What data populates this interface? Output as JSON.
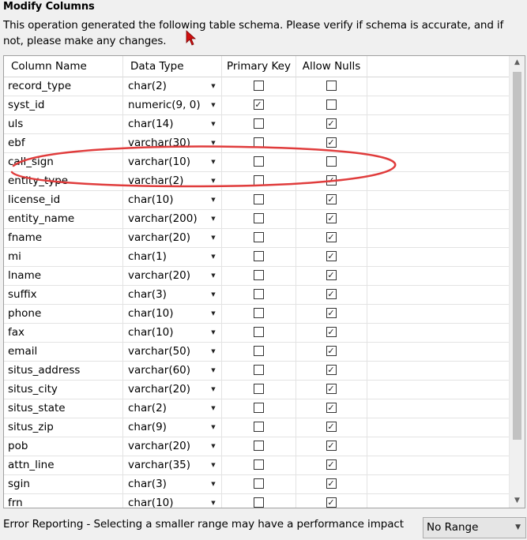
{
  "header": {
    "title": "Modify Columns",
    "description": "This operation generated the following table schema. Please verify if schema is accurate, and if not, please make any changes."
  },
  "grid": {
    "columns": [
      "Column Name",
      "Data Type",
      "Primary Key",
      "Allow Nulls"
    ],
    "rows": [
      {
        "name": "record_type",
        "type": "char(2)",
        "pk": false,
        "nulls": false
      },
      {
        "name": "syst_id",
        "type": "numeric(9, 0)",
        "pk": true,
        "nulls": false
      },
      {
        "name": "uls",
        "type": "char(14)",
        "pk": false,
        "nulls": true
      },
      {
        "name": "ebf",
        "type": "varchar(30)",
        "pk": false,
        "nulls": true
      },
      {
        "name": "call_sign",
        "type": "varchar(10)",
        "pk": false,
        "nulls": false
      },
      {
        "name": "entity_type",
        "type": "varchar(2)",
        "pk": false,
        "nulls": true
      },
      {
        "name": "license_id",
        "type": "char(10)",
        "pk": false,
        "nulls": true
      },
      {
        "name": "entity_name",
        "type": "varchar(200)",
        "pk": false,
        "nulls": true
      },
      {
        "name": "fname",
        "type": "varchar(20)",
        "pk": false,
        "nulls": true
      },
      {
        "name": "mi",
        "type": "char(1)",
        "pk": false,
        "nulls": true
      },
      {
        "name": "lname",
        "type": "varchar(20)",
        "pk": false,
        "nulls": true
      },
      {
        "name": "suffix",
        "type": "char(3)",
        "pk": false,
        "nulls": true
      },
      {
        "name": "phone",
        "type": "char(10)",
        "pk": false,
        "nulls": true
      },
      {
        "name": "fax",
        "type": "char(10)",
        "pk": false,
        "nulls": true
      },
      {
        "name": "email",
        "type": "varchar(50)",
        "pk": false,
        "nulls": true
      },
      {
        "name": "situs_address",
        "type": "varchar(60)",
        "pk": false,
        "nulls": true
      },
      {
        "name": "situs_city",
        "type": "varchar(20)",
        "pk": false,
        "nulls": true
      },
      {
        "name": "situs_state",
        "type": "char(2)",
        "pk": false,
        "nulls": true
      },
      {
        "name": "situs_zip",
        "type": "char(9)",
        "pk": false,
        "nulls": true
      },
      {
        "name": "pob",
        "type": "varchar(20)",
        "pk": false,
        "nulls": true
      },
      {
        "name": "attn_line",
        "type": "varchar(35)",
        "pk": false,
        "nulls": true
      },
      {
        "name": "sgin",
        "type": "char(3)",
        "pk": false,
        "nulls": true
      },
      {
        "name": "frn",
        "type": "char(10)",
        "pk": false,
        "nulls": true
      }
    ]
  },
  "footer": {
    "label": "Error Reporting - Selecting a smaller range may have a performance impact",
    "range_value": "No Range"
  },
  "colors": {
    "annotation": "#e03c3c",
    "cursor": "#d01010"
  }
}
